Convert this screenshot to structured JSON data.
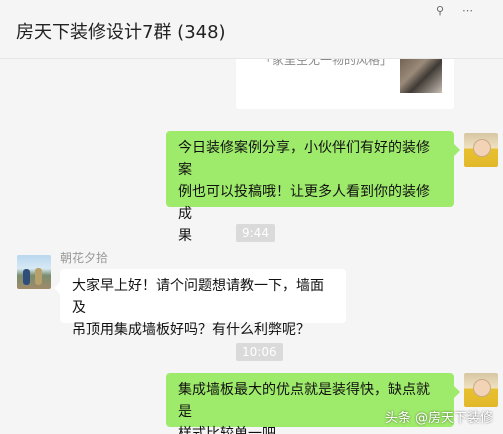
{
  "window": {
    "title": "房天下装修设计7群 (348)",
    "controls": [
      "pin-icon",
      "more-icon"
    ]
  },
  "chat": {
    "card": {
      "text": "「家里空无一物的风格」",
      "thumb": "living-room-image"
    },
    "messages": [
      {
        "side": "me",
        "text": "今日装修案例分享，小伙伴们有好的装修案例也可以投稿哦！让更多人看到你的装修成果",
        "lines": [
          "今日装修案例分享，小伙伴们有好的装修案",
          "例也可以投稿哦！让更多人看到你的装修成",
          "果"
        ]
      },
      {
        "type": "time",
        "text": "9:44"
      },
      {
        "side": "other",
        "sender": "朝花夕拾",
        "lines": [
          "大家早上好！请个问题想请教一下，墙面及",
          "吊顶用集成墙板好吗？有什么利弊呢？"
        ]
      },
      {
        "type": "time",
        "text": "10:06"
      },
      {
        "side": "me",
        "lines": [
          "集成墙板最大的优点就是装得快，缺点就是",
          "样式比较单一吧"
        ]
      }
    ]
  },
  "watermark": "头条 @房天下装修",
  "colors": {
    "my_bubble": "#9eea6a",
    "other_bubble": "#ffffff",
    "bg": "#f5f5f5"
  }
}
